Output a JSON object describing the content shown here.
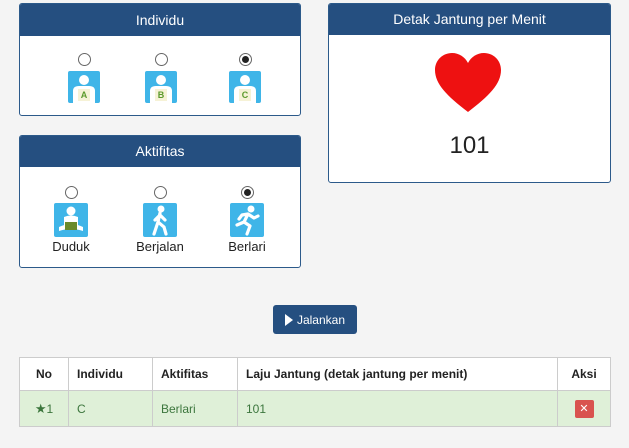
{
  "individu_panel": {
    "title": "Individu",
    "options": [
      {
        "letter": "A",
        "checked": false
      },
      {
        "letter": "B",
        "checked": false
      },
      {
        "letter": "C",
        "checked": true
      }
    ]
  },
  "heart_panel": {
    "title": "Detak Jantung per Menit",
    "bpm": "101",
    "heart_color": "#ee1111"
  },
  "activity_panel": {
    "title": "Aktifitas",
    "options": [
      {
        "label": "Duduk",
        "icon": "sitting-person-icon",
        "checked": false
      },
      {
        "label": "Berjalan",
        "icon": "walking-person-icon",
        "checked": false
      },
      {
        "label": "Berlari",
        "icon": "running-person-icon",
        "checked": true
      }
    ]
  },
  "run_button": {
    "label": "Jalankan"
  },
  "table": {
    "headers": [
      "No",
      "Individu",
      "Aktifitas",
      "Laju Jantung (detak jantung per menit)",
      "Aksi"
    ],
    "rows": [
      {
        "no": "1",
        "individu": "C",
        "aktifitas": "Berlari",
        "laju": "101"
      }
    ]
  },
  "colors": {
    "panel_header": "#254f80",
    "icon_bg": "#3fb5e8",
    "row_success": "#dff0d8",
    "delete": "#d9534f"
  }
}
